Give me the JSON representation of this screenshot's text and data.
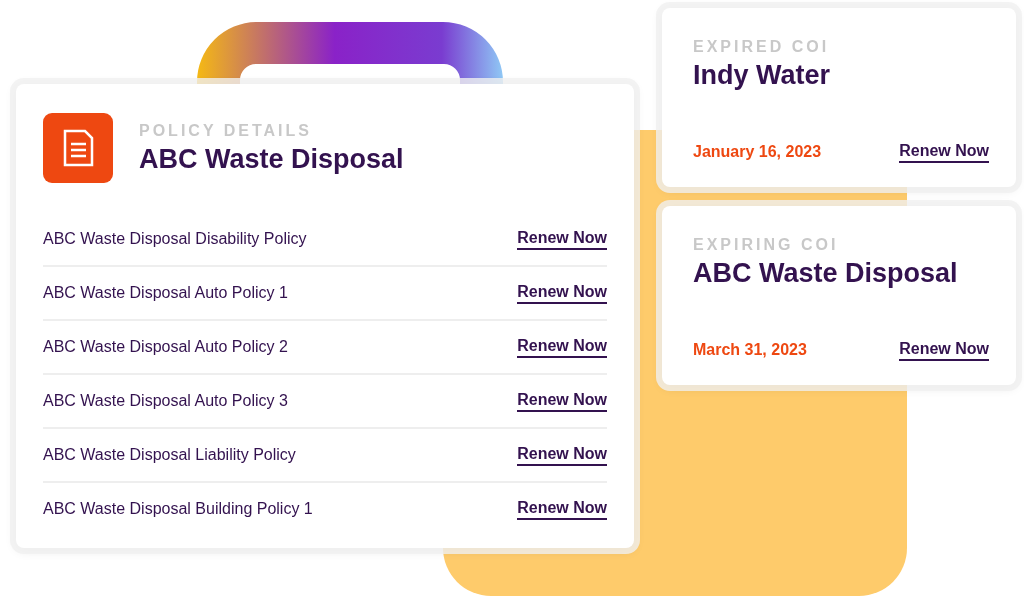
{
  "policy_card": {
    "label": "POLICY DETAILS",
    "title": "ABC Waste Disposal",
    "rows": [
      {
        "name": "ABC Waste Disposal Disability Policy",
        "action": "Renew Now"
      },
      {
        "name": "ABC Waste Disposal Auto Policy 1",
        "action": "Renew Now"
      },
      {
        "name": "ABC Waste Disposal Auto Policy 2",
        "action": "Renew Now"
      },
      {
        "name": "ABC Waste Disposal Auto Policy 3",
        "action": "Renew Now"
      },
      {
        "name": "ABC Waste Disposal Liability Policy",
        "action": "Renew Now"
      },
      {
        "name": "ABC Waste Disposal Building Policy 1",
        "action": "Renew Now"
      }
    ]
  },
  "coi_cards": [
    {
      "label": "EXPIRED COI",
      "title": "Indy Water",
      "date": "January 16, 2023",
      "action": "Renew Now"
    },
    {
      "label": "EXPIRING COI",
      "title": "ABC Waste Disposal",
      "date": "March 31, 2023",
      "action": "Renew Now"
    }
  ]
}
